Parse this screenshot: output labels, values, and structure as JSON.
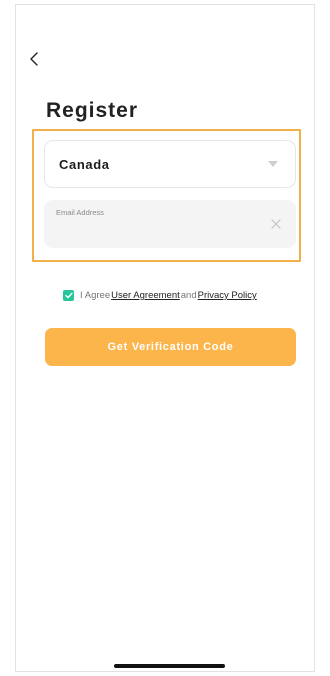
{
  "header": {
    "back_icon": "chevron-left-icon"
  },
  "page": {
    "title": "Register"
  },
  "form": {
    "country_value": "Canada",
    "country_caret_icon": "caret-down-icon",
    "email_label": "Email Address",
    "email_value": "",
    "clear_icon": "close-icon"
  },
  "agreement": {
    "checked": true,
    "prefix": "I Agree",
    "user_agreement": "User Agreement",
    "conjunction": "and",
    "privacy_policy": "Privacy Policy"
  },
  "cta": {
    "label": "Get Verification Code"
  },
  "colors": {
    "accent": "#fcb54a",
    "highlight_border": "#f2b04b",
    "checkbox": "#27c69a"
  }
}
